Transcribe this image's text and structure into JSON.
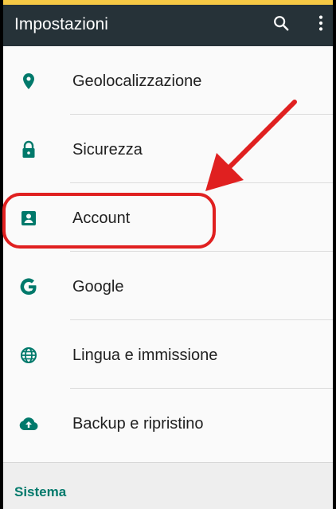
{
  "appbar": {
    "title": "Impostazioni",
    "search_icon": "search-icon",
    "more_icon": "more-vert-icon",
    "background": "#263238"
  },
  "settings": {
    "items": [
      {
        "label": "Geolocalizzazione",
        "icon": "location-pin-icon"
      },
      {
        "label": "Sicurezza",
        "icon": "lock-icon"
      },
      {
        "label": "Account",
        "icon": "account-box-icon"
      },
      {
        "label": "Google",
        "icon": "google-icon"
      },
      {
        "label": "Lingua e immissione",
        "icon": "globe-icon"
      },
      {
        "label": "Backup e ripristino",
        "icon": "cloud-upload-icon"
      }
    ]
  },
  "section": {
    "label": "Sistema"
  },
  "colors": {
    "icon_tint": "#00796b",
    "accent": "#00796b",
    "annotation": "#e02020"
  }
}
